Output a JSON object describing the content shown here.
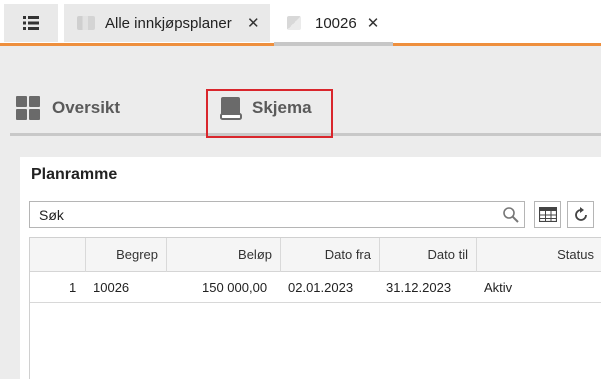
{
  "topbar": {
    "menu_icon": "list-icon",
    "tabs": [
      {
        "label": "Alle innkjøpsplaner",
        "close": "✕"
      },
      {
        "label": "10026",
        "close": "✕"
      }
    ]
  },
  "section_nav": {
    "items": [
      {
        "label": "Oversikt",
        "icon": "grid-icon"
      },
      {
        "label": "Skjema",
        "icon": "book-icon"
      }
    ]
  },
  "panel": {
    "title": "Planramme",
    "search": {
      "placeholder": "Søk",
      "value": ""
    },
    "toolbar": {
      "table_icon": "table-view-icon",
      "refresh_icon": "refresh-icon"
    }
  },
  "table": {
    "columns": [
      "",
      "Begrep",
      "Beløp",
      "Dato fra",
      "Dato til",
      "Status"
    ],
    "rows": [
      {
        "index": "1",
        "begrep": "10026",
        "belop": "150 000,00",
        "dato_fra": "02.01.2023",
        "dato_til": "31.12.2023",
        "status": "Aktiv"
      }
    ]
  },
  "colors": {
    "accent": "#ee8f3d",
    "highlight": "#d9262c",
    "icon_gray": "#6a6a6a"
  }
}
